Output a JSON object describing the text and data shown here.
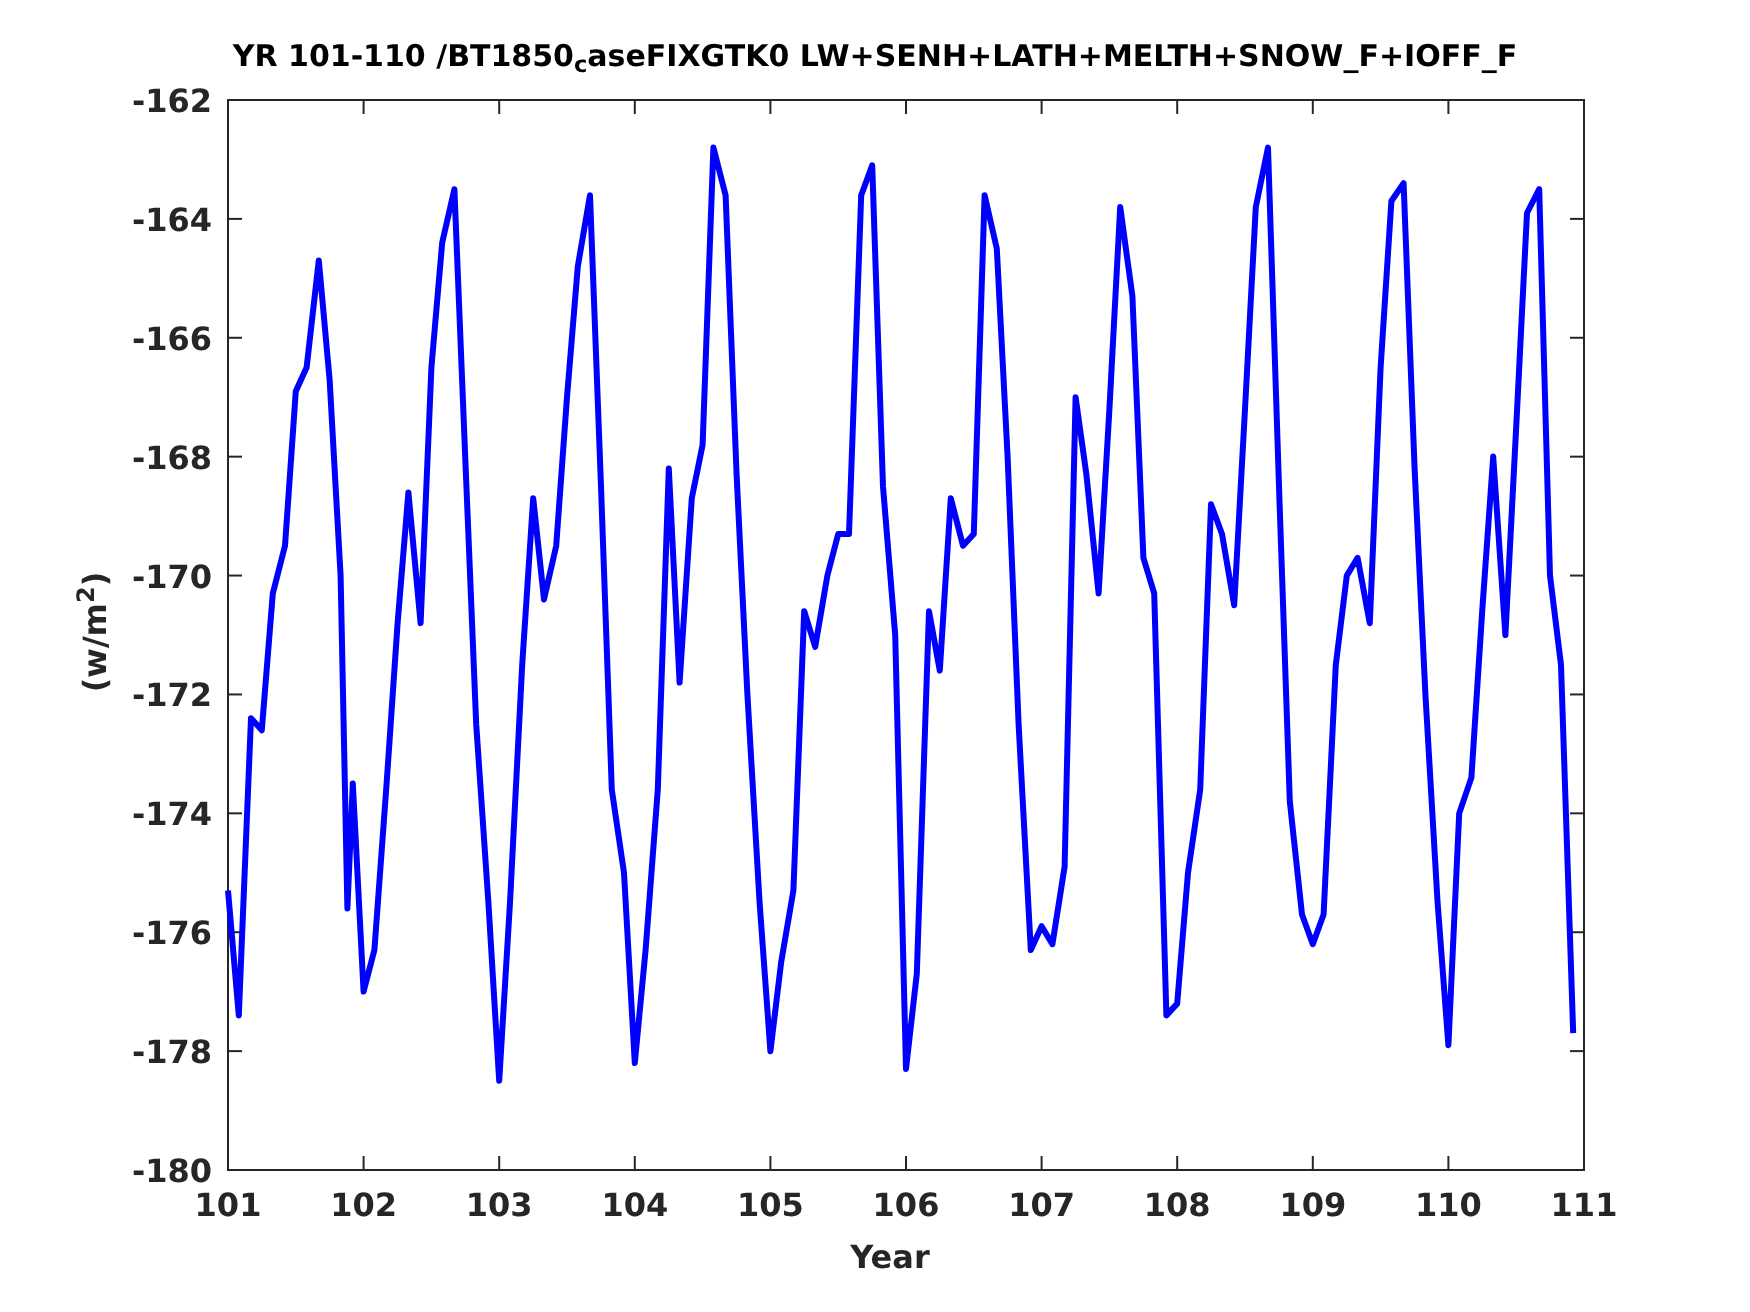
{
  "figure": {
    "chart_data": {
      "type": "line",
      "title": "YR 101-110 /BT1850$_{c}$aseFIXGTK0 LW+SENH+LATH+MELTH+SNOW_F+IOFF_F",
      "xlabel": "Year",
      "ylabel": "(w/m$^{2}$)",
      "x": [
        101.0,
        101.08,
        101.17,
        101.25,
        101.33,
        101.42,
        101.5,
        101.58,
        101.67,
        101.75,
        101.83,
        101.88,
        101.92,
        102.0,
        102.08,
        102.17,
        102.25,
        102.33,
        102.42,
        102.5,
        102.58,
        102.67,
        102.75,
        102.83,
        102.92,
        103.0,
        103.08,
        103.17,
        103.25,
        103.33,
        103.42,
        103.5,
        103.58,
        103.67,
        103.75,
        103.83,
        103.92,
        104.0,
        104.08,
        104.17,
        104.25,
        104.33,
        104.42,
        104.5,
        104.58,
        104.67,
        104.75,
        104.83,
        104.92,
        105.0,
        105.08,
        105.17,
        105.25,
        105.33,
        105.42,
        105.5,
        105.58,
        105.67,
        105.75,
        105.83,
        105.92,
        106.0,
        106.08,
        106.17,
        106.25,
        106.33,
        106.42,
        106.5,
        106.58,
        106.67,
        106.75,
        106.83,
        106.92,
        107.0,
        107.08,
        107.17,
        107.25,
        107.33,
        107.42,
        107.5,
        107.58,
        107.67,
        107.75,
        107.83,
        107.92,
        108.0,
        108.08,
        108.17,
        108.25,
        108.33,
        108.42,
        108.5,
        108.58,
        108.67,
        108.75,
        108.83,
        108.92,
        109.0,
        109.08,
        109.17,
        109.25,
        109.33,
        109.42,
        109.5,
        109.58,
        109.67,
        109.75,
        109.83,
        109.92,
        110.0,
        110.08,
        110.17,
        110.25,
        110.33,
        110.42,
        110.5,
        110.58,
        110.67,
        110.75,
        110.83,
        110.92
      ],
      "series": [
        {
          "color": "#0000ff",
          "values": [
            -175.3,
            -177.4,
            -172.4,
            -172.6,
            -170.3,
            -169.5,
            -166.9,
            -166.5,
            -164.7,
            -166.7,
            -170.0,
            -175.6,
            -173.5,
            -177.0,
            -176.3,
            -173.5,
            -170.8,
            -168.6,
            -170.8,
            -166.5,
            -164.4,
            -163.5,
            -168.0,
            -172.5,
            -175.5,
            -178.5,
            -175.5,
            -171.5,
            -168.7,
            -170.4,
            -169.5,
            -167.0,
            -164.8,
            -163.6,
            -168.5,
            -173.6,
            -175.0,
            -178.2,
            -176.3,
            -173.6,
            -168.2,
            -171.8,
            -168.7,
            -167.8,
            -162.8,
            -163.6,
            -168.3,
            -172.0,
            -175.5,
            -178.0,
            -176.5,
            -175.3,
            -170.6,
            -171.2,
            -170.0,
            -169.3,
            -169.3,
            -163.6,
            -163.1,
            -168.5,
            -171.0,
            -178.3,
            -176.7,
            -170.6,
            -171.6,
            -168.7,
            -169.5,
            -169.3,
            -163.6,
            -164.5,
            -168.0,
            -172.5,
            -176.3,
            -175.9,
            -176.2,
            -174.9,
            -167.0,
            -168.3,
            -170.3,
            -167.2,
            -163.8,
            -165.3,
            -169.7,
            -170.3,
            -177.4,
            -177.2,
            -175.0,
            -173.6,
            -168.8,
            -169.3,
            -170.5,
            -167.2,
            -163.8,
            -162.8,
            -168.5,
            -173.8,
            -175.7,
            -176.2,
            -175.7,
            -171.5,
            -170.0,
            -169.7,
            -170.8,
            -166.5,
            -163.7,
            -163.4,
            -168.2,
            -172.0,
            -175.5,
            -177.9,
            -174.0,
            -173.4,
            -170.6,
            -168.0,
            -171.0,
            -167.5,
            -163.9,
            -163.5,
            -170.0,
            -171.5,
            -177.7
          ]
        }
      ],
      "xlim": [
        101,
        111
      ],
      "ylim": [
        -180,
        -162
      ],
      "xticks": [
        101,
        102,
        103,
        104,
        105,
        106,
        107,
        108,
        109,
        110,
        111
      ],
      "yticks": [
        -180,
        -178,
        -176,
        -174,
        -172,
        -170,
        -168,
        -166,
        -164,
        -162
      ]
    }
  }
}
